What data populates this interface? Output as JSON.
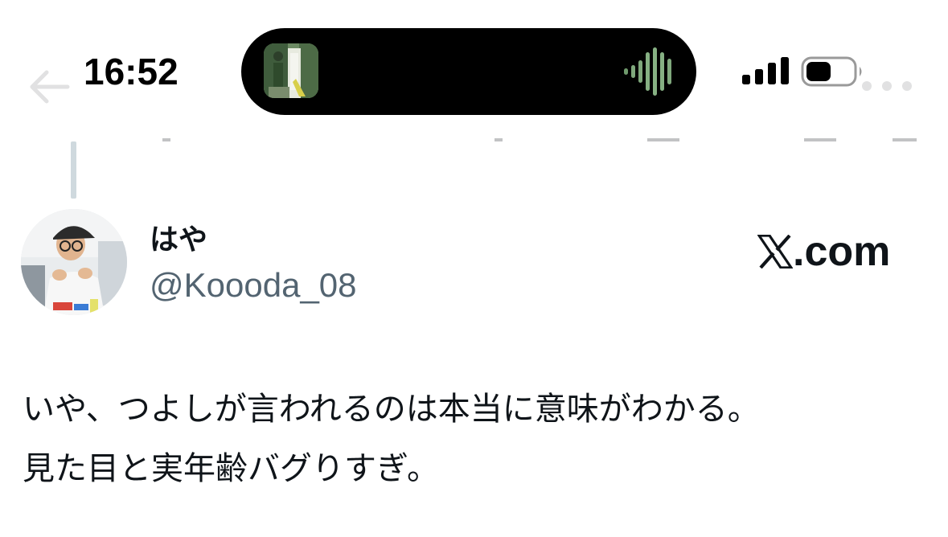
{
  "status_bar": {
    "time": "16:52",
    "signal_icon": "cellular-signal-icon",
    "battery_icon": "battery-icon",
    "island_icon": "audio-waveform-icon"
  },
  "nav": {
    "back_icon": "back-arrow-icon",
    "more_icon": "more-dots-icon"
  },
  "tweet": {
    "display_name": "はや",
    "handle": "@Koooda_08",
    "source_label": ".com",
    "source_icon": "x-logo-icon",
    "text_lines": [
      "いや、つよしが言われるのは本当に意味がわかる。",
      "見た目と実年齢バグりすぎ。"
    ]
  },
  "colors": {
    "text_primary": "#0f1419",
    "text_secondary": "#536471",
    "thread_line": "#cfd9de",
    "island_bg": "#000000",
    "waveform": "#7fa87c"
  }
}
